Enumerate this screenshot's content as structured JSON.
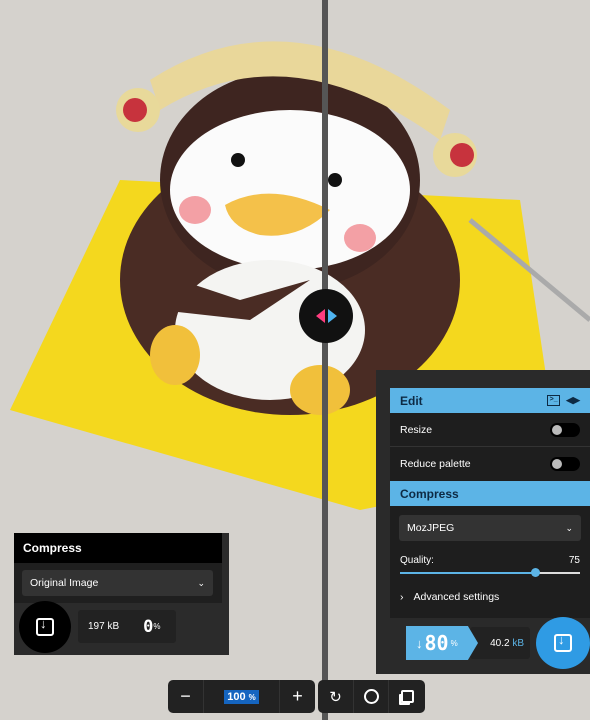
{
  "right_panel": {
    "edit_title": "Edit",
    "resize_label": "Resize",
    "resize_on": false,
    "reduce_palette_label": "Reduce palette",
    "reduce_palette_on": false,
    "compress_title": "Compress",
    "codec": "MozJPEG",
    "quality_label": "Quality:",
    "quality_value": "75",
    "quality": 75,
    "advanced_label": "Advanced settings",
    "savings_arrow": "↓",
    "savings_value": "80",
    "savings_unit": "%",
    "size_value": "40.2",
    "size_unit": "kB"
  },
  "left_panel": {
    "compress_title": "Compress",
    "codec": "Original Image",
    "size_value": "197",
    "size_unit": "kB",
    "savings_value": "0",
    "savings_unit": "%"
  },
  "toolbar": {
    "zoom_out": "−",
    "zoom_value": "100",
    "zoom_unit": "%",
    "zoom_in": "+"
  },
  "colors": {
    "accent": "#5cb4e6",
    "handle_left": "#ff3d7f",
    "handle_right": "#4fb4f0"
  }
}
